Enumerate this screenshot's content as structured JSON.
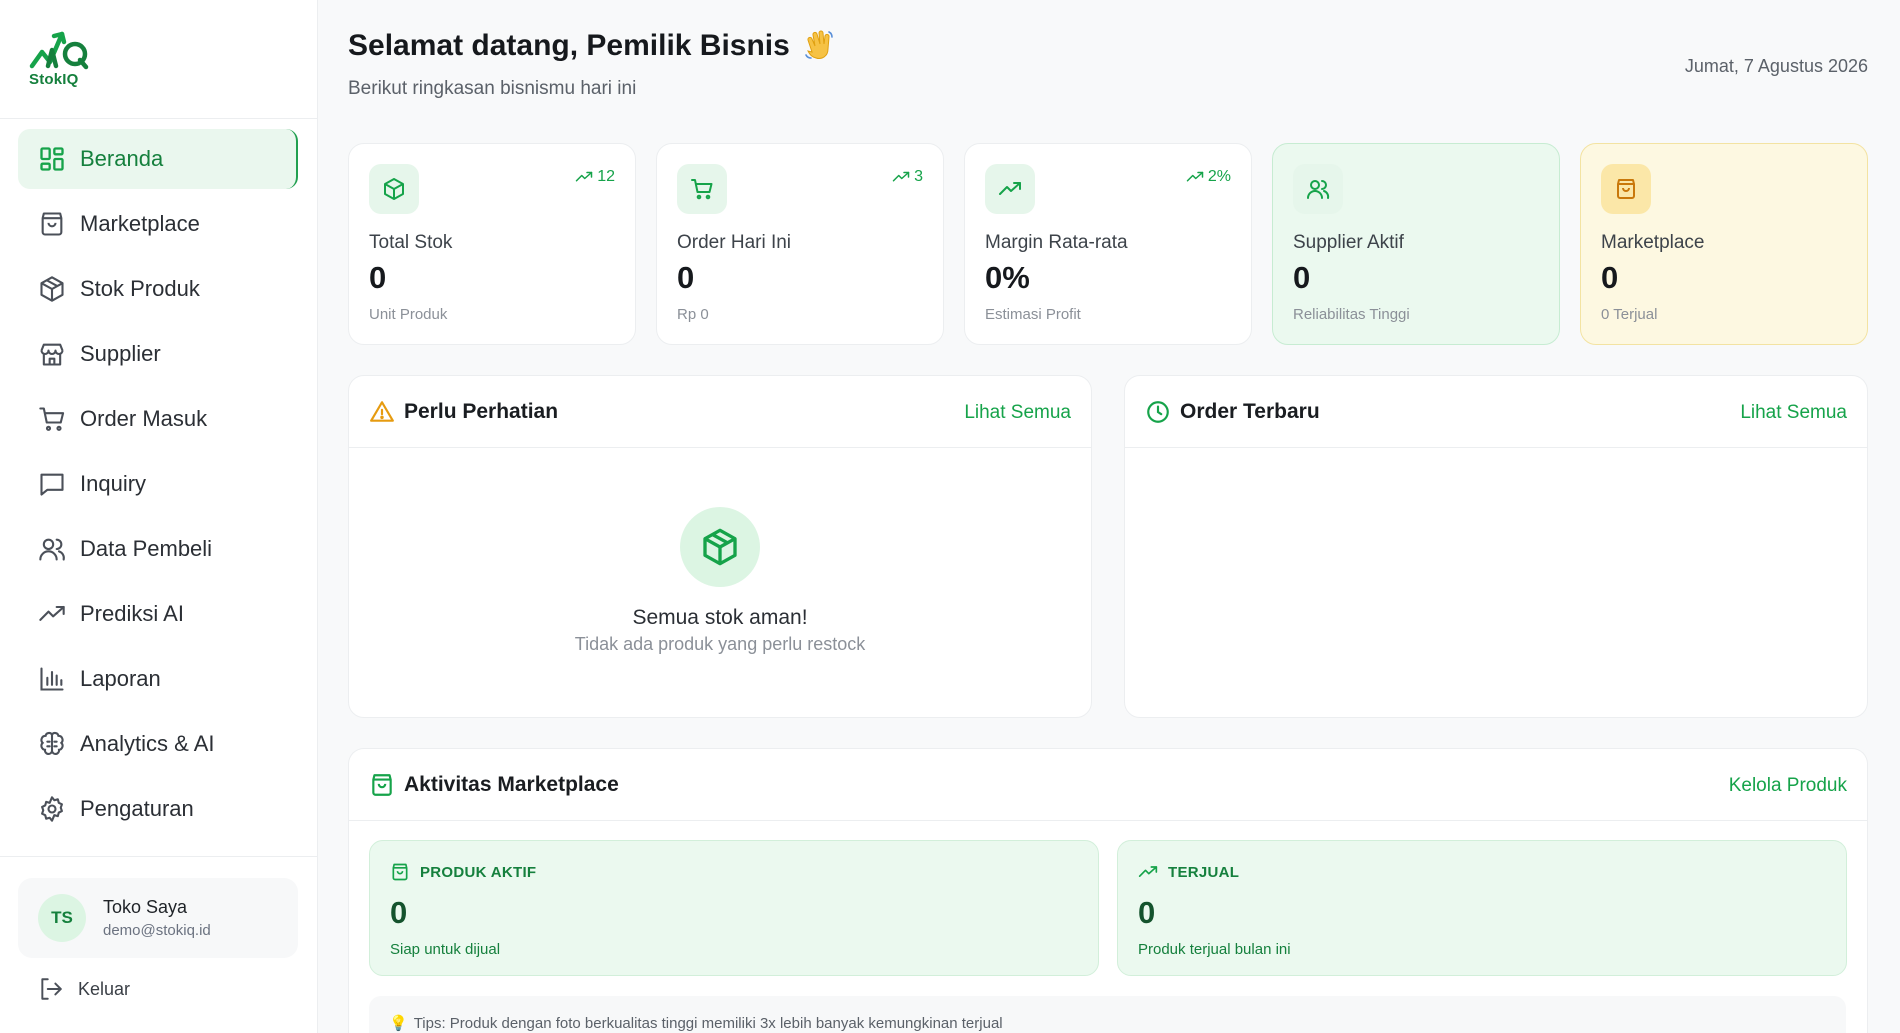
{
  "app": {
    "name": "StokIQ",
    "brand_color": "#16a34a"
  },
  "sidebar": {
    "items": [
      {
        "label": "Beranda",
        "icon": "grid-icon",
        "active": true
      },
      {
        "label": "Marketplace",
        "icon": "shopping-bag-icon"
      },
      {
        "label": "Stok Produk",
        "icon": "box-icon"
      },
      {
        "label": "Supplier",
        "icon": "store-icon"
      },
      {
        "label": "Order Masuk",
        "icon": "cart-icon"
      },
      {
        "label": "Inquiry",
        "icon": "message-icon"
      },
      {
        "label": "Data Pembeli",
        "icon": "users-icon"
      },
      {
        "label": "Prediksi AI",
        "icon": "trend-icon"
      },
      {
        "label": "Laporan",
        "icon": "bar-chart-icon"
      },
      {
        "label": "Analytics & AI",
        "icon": "brain-icon"
      },
      {
        "label": "Pengaturan",
        "icon": "gear-icon"
      }
    ],
    "user": {
      "initials": "TS",
      "name": "Toko Saya",
      "email": "demo@stokiq.id"
    },
    "logout_label": "Keluar"
  },
  "header": {
    "greeting": "Selamat datang, Pemilik Bisnis",
    "subtitle": "Berikut ringkasan bisnismu hari ini",
    "date": "Jumat, 7 Agustus 2026"
  },
  "stats": [
    {
      "title": "Total Stok",
      "value": "0",
      "desc": "Unit Produk",
      "trend": "12",
      "icon": "box-icon",
      "variant": "white"
    },
    {
      "title": "Order Hari Ini",
      "value": "0",
      "desc": "Rp 0",
      "trend": "3",
      "icon": "cart-icon",
      "variant": "white"
    },
    {
      "title": "Margin Rata-rata",
      "value": "0%",
      "desc": "Estimasi Profit",
      "trend": "2%",
      "icon": "trend-icon",
      "variant": "white"
    },
    {
      "title": "Supplier Aktif",
      "value": "0",
      "desc": "Reliabilitas Tinggi",
      "icon": "users-icon",
      "variant": "green"
    },
    {
      "title": "Marketplace",
      "value": "0",
      "desc": "0 Terjual",
      "icon": "shopping-bag-icon",
      "variant": "yellow"
    }
  ],
  "attention": {
    "title": "Perlu Perhatian",
    "link": "Lihat Semua",
    "empty_title": "Semua stok aman!",
    "empty_desc": "Tidak ada produk yang perlu restock"
  },
  "orders": {
    "title": "Order Terbaru",
    "link": "Lihat Semua"
  },
  "marketplace": {
    "title": "Aktivitas Marketplace",
    "link": "Kelola Produk",
    "active": {
      "label": "PRODUK AKTIF",
      "value": "0",
      "desc": "Siap untuk dijual"
    },
    "sold": {
      "label": "TERJUAL",
      "value": "0",
      "desc": "Produk terjual bulan ini"
    },
    "tip": "Tips: Produk dengan foto berkualitas tinggi memiliki 3x lebih banyak kemungkinan terjual"
  }
}
